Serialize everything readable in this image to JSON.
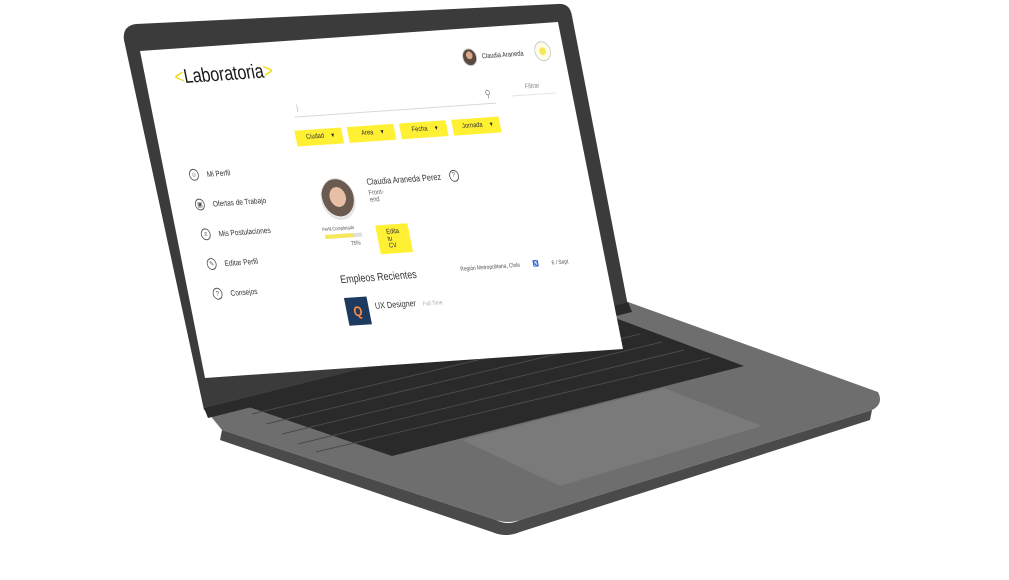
{
  "app": {
    "logo_open": "<",
    "logo_text": "Laboratoria",
    "logo_close": ">"
  },
  "header": {
    "user_name": "Claudia Araneda",
    "search_placeholder": "|",
    "filter_label": "Filtrar"
  },
  "filters": [
    {
      "label": "Ciudad"
    },
    {
      "label": "Area"
    },
    {
      "label": "Fecha"
    },
    {
      "label": "Jornada"
    }
  ],
  "sidebar": {
    "items": [
      {
        "label": "Mi Perfil",
        "icon": "user-icon"
      },
      {
        "label": "Ofertas de Trabajo",
        "icon": "briefcase-icon"
      },
      {
        "label": "Mis Postulaciones",
        "icon": "list-icon"
      },
      {
        "label": "Editar Perfil",
        "icon": "edit-icon"
      },
      {
        "label": "Consejos",
        "icon": "help-icon"
      }
    ]
  },
  "profile": {
    "name": "Claudia Araneda Perez",
    "role": "Front-end",
    "completion_label": "Perfil Completado",
    "completion_value": "75%",
    "completion_fraction": 0.75,
    "edit_cv_label": "Edita tu CV"
  },
  "recent": {
    "title": "Empleos Recientes",
    "jobs": [
      {
        "title": "UX Designer",
        "type": "Full Time",
        "location": "Región Metropolitana, Chile",
        "date": "6 / Sept"
      }
    ]
  },
  "colors": {
    "accent": "#fff033",
    "laptop_body": "#5a5a5a",
    "screen_bezel": "#2b2b2b"
  }
}
